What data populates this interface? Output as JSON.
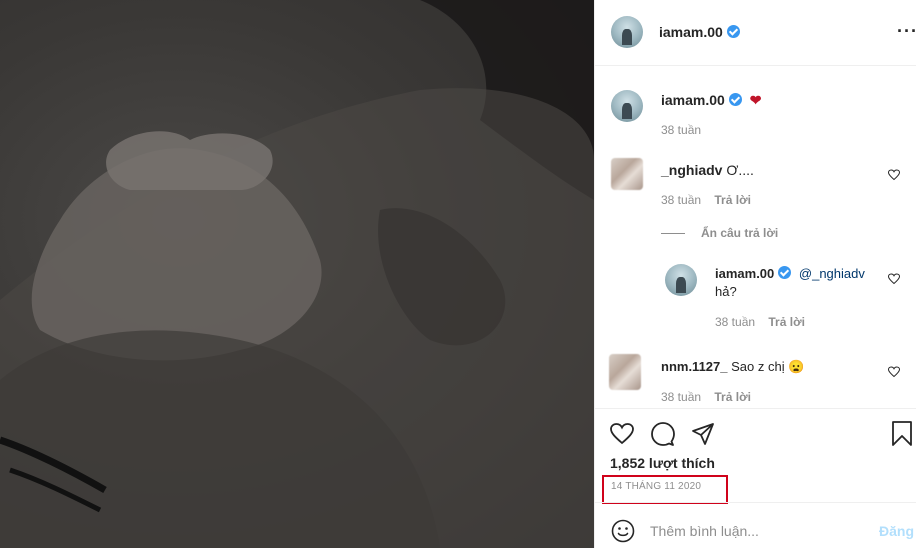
{
  "post": {
    "author": "iamam.00",
    "caption_emoji": "❤",
    "caption_time": "38 tuần"
  },
  "comments": [
    {
      "user": "_nghiadv",
      "text": "Ơ....",
      "time": "38 tuần",
      "reply_label": "Trả lời"
    },
    {
      "user": "iamam.00",
      "mention": "@_nghiadv",
      "text": "hả?",
      "time": "38 tuần",
      "reply_label": "Trả lời"
    },
    {
      "user": "nnm.1127_",
      "text": "Sao z chị",
      "emoji": "😦",
      "time": "38 tuần",
      "reply_label": "Trả lời"
    }
  ],
  "hide_replies_label": "Ẩn câu trả lời",
  "likes": "1,852 lượt thích",
  "date": "14 THÁNG 11 2020",
  "comment_placeholder": "Thêm bình luận...",
  "post_button": "Đăng",
  "colors": {
    "verified": "#3897f0",
    "highlight_box": "#d0021b",
    "post_button": "#b2dffc"
  }
}
